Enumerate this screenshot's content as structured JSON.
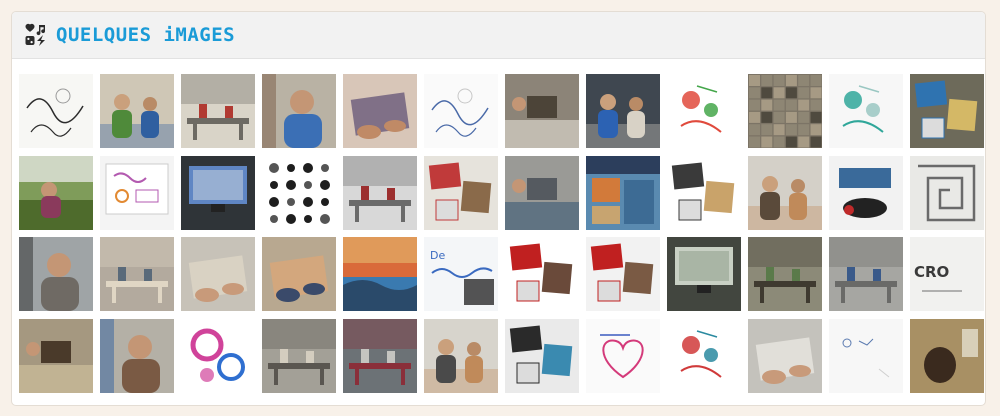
{
  "panel": {
    "title": "QUELQUES iMAGES",
    "icon": "art-shapes-icon",
    "accent": "#1a9bd7"
  },
  "gallery": {
    "rows": [
      [
        {
          "kind": "sketch",
          "bg": "#f7f7f4",
          "a": "#2c2c2c",
          "b": "#9a9a9a"
        },
        {
          "kind": "people",
          "bg": "#cfc7b6",
          "a": "#4f8a3a",
          "b": "#2f5fa0"
        },
        {
          "kind": "room",
          "bg": "#d9d4c8",
          "a": "#b13a32",
          "b": "#6d6a63"
        },
        {
          "kind": "portrait",
          "bg": "#b9b2a4",
          "a": "#7a5a44",
          "b": "#3b6fb5"
        },
        {
          "kind": "hands",
          "bg": "#d8c6b8",
          "a": "#6a5a7a",
          "b": "#c08a66"
        },
        {
          "kind": "sketch",
          "bg": "#fafafa",
          "a": "#4a6aa8",
          "b": "#c7c7c7"
        },
        {
          "kind": "desk",
          "bg": "#8c8478",
          "a": "#e4e0d6",
          "b": "#4c4438"
        },
        {
          "kind": "people",
          "bg": "#3f4750",
          "a": "#2c62b3",
          "b": "#d8d2c6"
        },
        {
          "kind": "drawing",
          "bg": "#ffffff",
          "a": "#e04a3c",
          "b": "#44a64a"
        },
        {
          "kind": "mosaic",
          "bg": "#7c7466",
          "a": "#a69a84",
          "b": "#4f4a3f"
        },
        {
          "kind": "drawing",
          "bg": "#f7f7f7",
          "a": "#30a79a",
          "b": "#9ac7c2"
        },
        {
          "kind": "collage",
          "bg": "#6d6a5a",
          "a": "#2f73b0",
          "b": "#d4b866"
        }
      ],
      [
        {
          "kind": "outdoor",
          "bg": "#7f9c5a",
          "a": "#8a3a5c",
          "b": "#4e6b2c"
        },
        {
          "kind": "board",
          "bg": "#f4f4f4",
          "a": "#b35ab0",
          "b": "#e28a33"
        },
        {
          "kind": "screen",
          "bg": "#2f3438",
          "a": "#5f86c4",
          "b": "#cfd8e0"
        },
        {
          "kind": "icons",
          "bg": "#ffffff",
          "a": "#1e1e1e",
          "b": "#555555"
        },
        {
          "kind": "room",
          "bg": "#d8d8d8",
          "a": "#9c2f2f",
          "b": "#6a6a6a"
        },
        {
          "kind": "collage",
          "bg": "#e6e3dc",
          "a": "#c03a3a",
          "b": "#8a6a4a"
        },
        {
          "kind": "desk",
          "bg": "#9a9a96",
          "a": "#3a5a74",
          "b": "#555a60"
        },
        {
          "kind": "poster",
          "bg": "#5a8ab0",
          "a": "#d27a3a",
          "b": "#2c3e5c"
        },
        {
          "kind": "collage",
          "bg": "#ffffff",
          "a": "#3a3a3a",
          "b": "#c9a36a"
        },
        {
          "kind": "people",
          "bg": "#d4d0c8",
          "a": "#5a4a3a",
          "b": "#c08a5a"
        },
        {
          "kind": "photo",
          "bg": "#f2f2f2",
          "a": "#3a6a9a",
          "b": "#c02a2a"
        },
        {
          "kind": "maze",
          "bg": "#e9e9e6",
          "a": "#6a6a6a",
          "b": "#b0b0b0"
        }
      ],
      [
        {
          "kind": "portrait",
          "bg": "#9fa4a6",
          "a": "#2a2a2a",
          "b": "#6f6a64"
        },
        {
          "kind": "room",
          "bg": "#b3aa9e",
          "a": "#5a6a7a",
          "b": "#e0d6c4"
        },
        {
          "kind": "hands",
          "bg": "#c7c2b8",
          "a": "#ddd6c6",
          "b": "#c89a7a"
        },
        {
          "kind": "hands",
          "bg": "#b8a890",
          "a": "#d9a678",
          "b": "#3a4a6a"
        },
        {
          "kind": "landscape",
          "bg": "#3a7ab0",
          "a": "#d96a3a",
          "b": "#2a4a6a"
        },
        {
          "kind": "handwriting",
          "bg": "#f4f6f8",
          "a": "#3a6ac0",
          "b": "#2a2a2a"
        },
        {
          "kind": "collage",
          "bg": "#ffffff",
          "a": "#c02020",
          "b": "#6a4a3a"
        },
        {
          "kind": "collage",
          "bg": "#f2f2f2",
          "a": "#c02020",
          "b": "#7a5a44"
        },
        {
          "kind": "screen",
          "bg": "#42463f",
          "a": "#c8d0c4",
          "b": "#8a9a86"
        },
        {
          "kind": "room",
          "bg": "#8c8a78",
          "a": "#5a7a4a",
          "b": "#3f3a30"
        },
        {
          "kind": "room",
          "bg": "#a6a6a2",
          "a": "#3a5a8a",
          "b": "#6a6a68"
        },
        {
          "kind": "croire",
          "bg": "#f1f1ef",
          "a": "#3a3a3a",
          "b": "#9a9a9a"
        }
      ],
      [
        {
          "kind": "desk",
          "bg": "#a59880",
          "a": "#d3c4a0",
          "b": "#4a3a2a"
        },
        {
          "kind": "portrait",
          "bg": "#b4b0a6",
          "a": "#2f5fa0",
          "b": "#7a5a44"
        },
        {
          "kind": "swirl",
          "bg": "#ffffff",
          "a": "#d0439a",
          "b": "#2f6fd0"
        },
        {
          "kind": "room",
          "bg": "#a3a097",
          "a": "#d4cdbf",
          "b": "#5a5650"
        },
        {
          "kind": "room",
          "bg": "#6c7276",
          "a": "#c4c4c0",
          "b": "#8a2f3a"
        },
        {
          "kind": "people",
          "bg": "#d7d4cc",
          "a": "#4a4a4a",
          "b": "#c08a5a"
        },
        {
          "kind": "collage",
          "bg": "#eaeaea",
          "a": "#2a2a2a",
          "b": "#3a8ab0"
        },
        {
          "kind": "heart",
          "bg": "#fafafa",
          "a": "#d43a7a",
          "b": "#3a5ac0"
        },
        {
          "kind": "drawing",
          "bg": "#ffffff",
          "a": "#d03a3a",
          "b": "#2a8aa0"
        },
        {
          "kind": "hands",
          "bg": "#c4c2bc",
          "a": "#e8e6e0",
          "b": "#c89a7a"
        },
        {
          "kind": "blank",
          "bg": "#f7f7f7",
          "a": "#5a7ab0",
          "b": "#cfcfcf"
        },
        {
          "kind": "animal",
          "bg": "#8a7452",
          "a": "#3a2a1e",
          "b": "#d8cfb8"
        }
      ]
    ]
  }
}
